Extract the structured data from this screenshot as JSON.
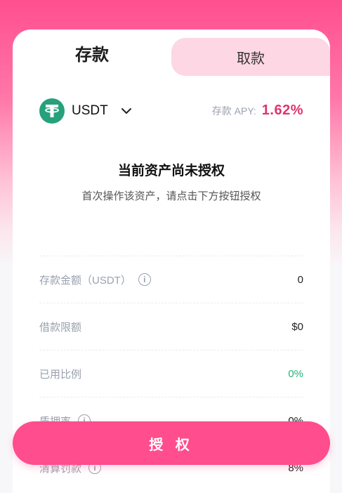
{
  "tabs": {
    "deposit_label": "存款",
    "withdraw_label": "取款"
  },
  "asset": {
    "symbol": "USDT",
    "icon": "tether-icon",
    "apy_label": "存款 APY:",
    "apy_value": "1.62%"
  },
  "notice": {
    "title": "当前资产尚未授权",
    "subtitle": "首次操作该资产，请点击下方按钮授权"
  },
  "info_rows": [
    {
      "label": "存款金额（USDT）",
      "value": "0",
      "has_info": true
    },
    {
      "label": "借款限额",
      "value": "$0",
      "has_info": false
    },
    {
      "label": "已用比例",
      "value": "0%",
      "has_info": false
    },
    {
      "label": "质押率",
      "value": "0%",
      "has_info": true
    },
    {
      "label": "清算罚款",
      "value": "8%",
      "has_info": true
    }
  ],
  "authorize_button": "授 权",
  "colors": {
    "accent": "#ff4d8d",
    "apy": "#e0336f",
    "positive": "#27b07d",
    "tether": "#26a17b"
  }
}
